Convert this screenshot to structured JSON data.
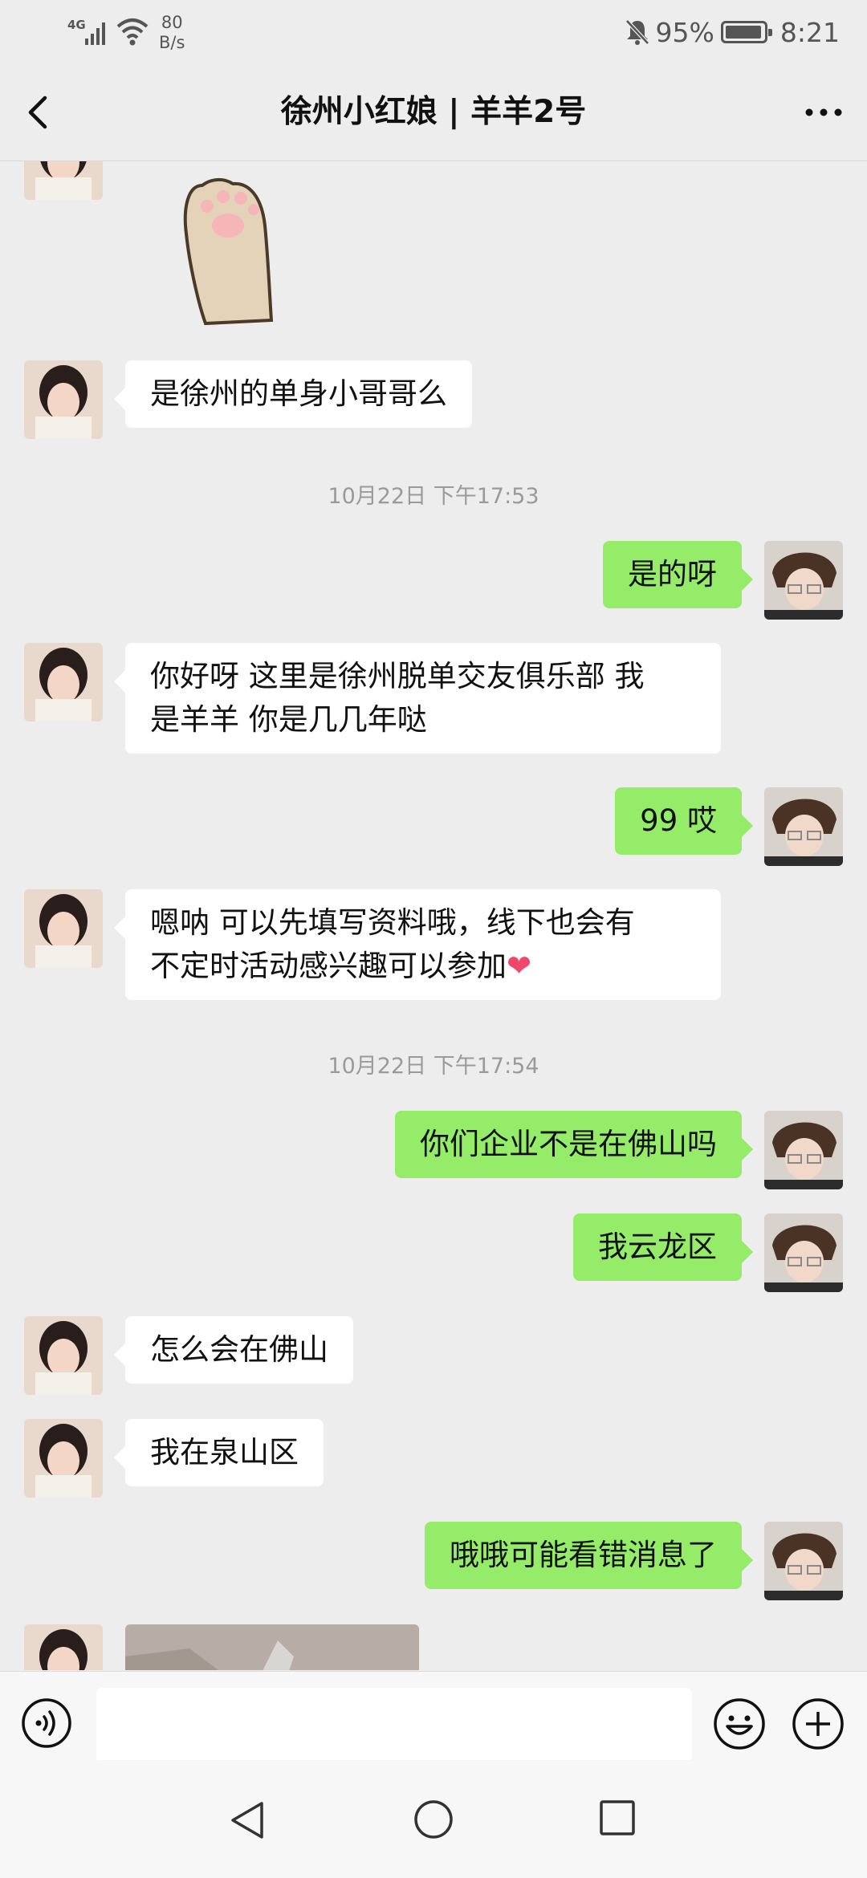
{
  "status_bar": {
    "network": "4G",
    "speed_value": "80",
    "speed_unit": "B/s",
    "battery": "95%",
    "battery_level": 0.95,
    "time": "8:21"
  },
  "header": {
    "title": "徐州小红娘 | 羊羊2号",
    "back_icon": "chevron-left-icon",
    "more_icon": "more-dots-icon"
  },
  "chat": {
    "messages": [
      {
        "type": "sticker",
        "from": "contact",
        "label": "cat-paw-sticker"
      },
      {
        "type": "text",
        "from": "contact",
        "text": "是徐州的单身小哥哥么"
      },
      {
        "type": "time",
        "text": "10月22日 下午17:53"
      },
      {
        "type": "text",
        "from": "me",
        "text": "是的呀"
      },
      {
        "type": "text",
        "from": "contact",
        "lines": [
          "你好呀 这里是徐州脱单交友俱乐部 我",
          "是羊羊 你是几几年哒"
        ]
      },
      {
        "type": "text",
        "from": "me",
        "text": "99 哎"
      },
      {
        "type": "text",
        "from": "contact",
        "lines": [
          "嗯呐 可以先填写资料哦，线下也会有",
          "不定时活动感兴趣可以参加"
        ],
        "emoji": "❤"
      },
      {
        "type": "time",
        "text": "10月22日 下午17:54"
      },
      {
        "type": "text",
        "from": "me",
        "text": "你们企业不是在佛山吗"
      },
      {
        "type": "text",
        "from": "me",
        "text": "我云龙区"
      },
      {
        "type": "text",
        "from": "contact",
        "text": "怎么会在佛山"
      },
      {
        "type": "text",
        "from": "contact",
        "text": "我在泉山区"
      },
      {
        "type": "text",
        "from": "me",
        "text": "哦哦可能看错消息了"
      },
      {
        "type": "image",
        "from": "contact",
        "label": "photo-message"
      }
    ]
  },
  "input_bar": {
    "voice_icon": "voice-icon",
    "emoji_icon": "emoji-icon",
    "plus_icon": "plus-icon",
    "value": ""
  },
  "nav_bar": {
    "back_icon": "nav-back-icon",
    "home_icon": "nav-home-icon",
    "recent_icon": "nav-recent-icon"
  },
  "colors": {
    "background": "#ededed",
    "incoming_bubble": "#ffffff",
    "outgoing_bubble": "#95ec69",
    "timestamp": "#9a9a9a"
  }
}
